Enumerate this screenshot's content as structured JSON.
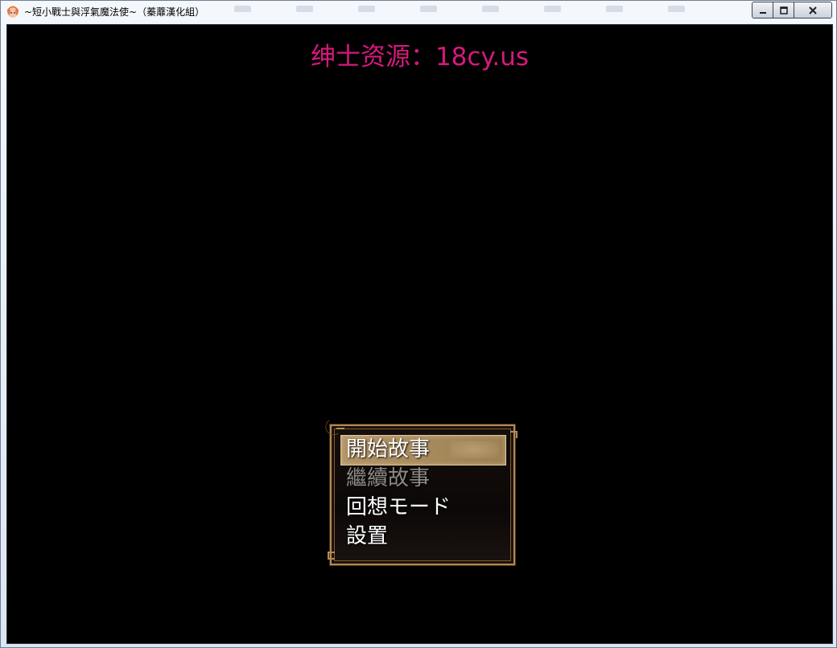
{
  "window": {
    "title": "~短小戰士與浮氣魔法使~（蓁蘼漢化組）",
    "accent": "#6e7f93"
  },
  "caption_buttons": {
    "minimize_icon": "minimize-icon",
    "maximize_icon": "maximize-icon",
    "close_icon": "close-icon"
  },
  "game": {
    "watermark": "绅士资源：18cy.us",
    "watermark_color": "#d6197d",
    "menu": {
      "items": [
        {
          "label": "開始故事",
          "state": "selected"
        },
        {
          "label": "繼續故事",
          "state": "disabled"
        },
        {
          "label": "回想モード",
          "state": "normal"
        },
        {
          "label": "設置",
          "state": "normal"
        }
      ]
    }
  }
}
